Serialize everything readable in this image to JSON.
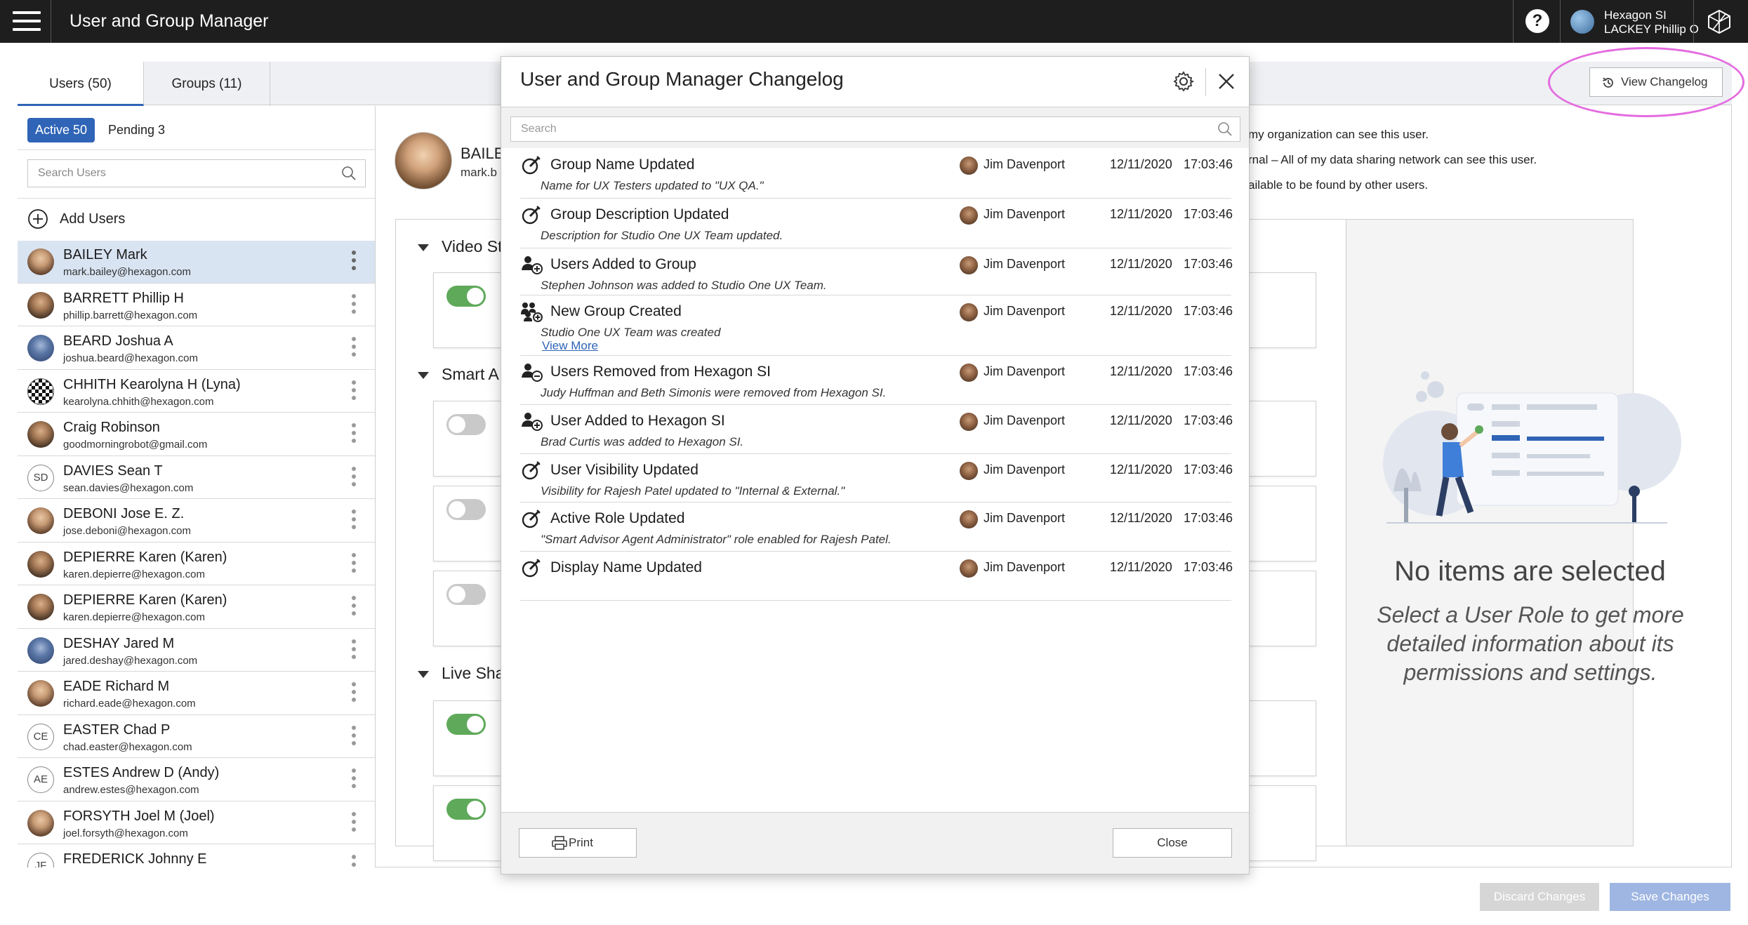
{
  "app": {
    "title": "User and Group Manager"
  },
  "account": {
    "org": "Hexagon SI",
    "name": "LACKEY Phillip O"
  },
  "tabs": [
    {
      "label": "Users (50)"
    },
    {
      "label": "Groups (11)"
    }
  ],
  "changelog_button": {
    "label": "View Changelog"
  },
  "filters": {
    "active": "Active 50",
    "pending": "Pending 3"
  },
  "user_search": {
    "placeholder": "Search Users"
  },
  "add_users": {
    "label": "Add Users"
  },
  "users": [
    {
      "name": "BAILEY Mark",
      "email": "mark.bailey@hexagon.com",
      "avatar": "photo",
      "initials": ""
    },
    {
      "name": "BARRETT Phillip H",
      "email": "phillip.barrett@hexagon.com",
      "avatar": "photo2",
      "initials": ""
    },
    {
      "name": "BEARD Joshua A",
      "email": "joshua.beard@hexagon.com",
      "avatar": "photo3",
      "initials": ""
    },
    {
      "name": "CHHITH Kearolyna H (Lyna)",
      "email": "kearolyna.chhith@hexagon.com",
      "avatar": "checker",
      "initials": ""
    },
    {
      "name": "Craig Robinson",
      "email": "goodmorningrobot@gmail.com",
      "avatar": "photo2",
      "initials": ""
    },
    {
      "name": "DAVIES Sean T",
      "email": "sean.davies@hexagon.com",
      "avatar": "initials",
      "initials": "SD"
    },
    {
      "name": "DEBONI Jose E. Z.",
      "email": "jose.deboni@hexagon.com",
      "avatar": "photo",
      "initials": ""
    },
    {
      "name": "DEPIERRE Karen (Karen)",
      "email": "karen.depierre@hexagon.com",
      "avatar": "photo2",
      "initials": ""
    },
    {
      "name": "DEPIERRE Karen (Karen)",
      "email": "karen.depierre@hexagon.com",
      "avatar": "photo2",
      "initials": ""
    },
    {
      "name": "DESHAY Jared M",
      "email": "jared.deshay@hexagon.com",
      "avatar": "photo3",
      "initials": ""
    },
    {
      "name": "EADE Richard M",
      "email": "richard.eade@hexagon.com",
      "avatar": "photo",
      "initials": ""
    },
    {
      "name": "EASTER Chad P",
      "email": "chad.easter@hexagon.com",
      "avatar": "initials",
      "initials": "CE"
    },
    {
      "name": "ESTES Andrew D (Andy)",
      "email": "andrew.estes@hexagon.com",
      "avatar": "initials",
      "initials": "AE"
    },
    {
      "name": "FORSYTH Joel M (Joel)",
      "email": "joel.forsyth@hexagon.com",
      "avatar": "photo",
      "initials": ""
    },
    {
      "name": "FREDERICK Johnny E",
      "email": "",
      "avatar": "initials",
      "initials": "JF"
    }
  ],
  "detail": {
    "name": "BAILE",
    "email": "mark.b",
    "visibility_lines": [
      "my organization can see this user.",
      "rnal – All of my data sharing network can see this user.",
      "ailable to be found by other users."
    ],
    "sections": [
      "Video St",
      "Smart A",
      "Live Sha"
    ],
    "empty_title": "No items are selected",
    "empty_subtitle": "Select a User Role to get more detailed information about its permissions and settings."
  },
  "footer": {
    "discard": "Discard Changes",
    "save": "Save Changes"
  },
  "modal": {
    "title": "User and Group Manager Changelog",
    "search_placeholder": "Search",
    "print": "Print",
    "close": "Close",
    "entries": [
      {
        "icon": "edit-icon",
        "title": "Group Name Updated",
        "user": "Jim Davenport",
        "date": "12/11/2020",
        "time": "17:03:46",
        "desc": "Name for UX Testers updated to \"UX QA.\"",
        "more": ""
      },
      {
        "icon": "edit-icon",
        "title": "Group Description Updated",
        "user": "Jim Davenport",
        "date": "12/11/2020",
        "time": "17:03:46",
        "desc": "Description for Studio One UX Team updated.",
        "more": ""
      },
      {
        "icon": "user-add-icon",
        "title": "Users Added to Group",
        "user": "Jim Davenport",
        "date": "12/11/2020",
        "time": "17:03:46",
        "desc": "Stephen Johnson was added to Studio One UX Team.",
        "more": ""
      },
      {
        "icon": "group-add-icon",
        "title": "New Group Created",
        "user": "Jim Davenport",
        "date": "12/11/2020",
        "time": "17:03:46",
        "desc": "Studio One UX Team was created",
        "more": "View More"
      },
      {
        "icon": "user-remove-icon",
        "title": "Users Removed from Hexagon SI",
        "user": "Jim Davenport",
        "date": "12/11/2020",
        "time": "17:03:46",
        "desc": "Judy Huffman and Beth Simonis were removed from Hexagon SI.",
        "more": ""
      },
      {
        "icon": "user-add-icon",
        "title": "User Added to Hexagon SI",
        "user": "Jim Davenport",
        "date": "12/11/2020",
        "time": "17:03:46",
        "desc": "Brad Curtis was added to Hexagon SI.",
        "more": ""
      },
      {
        "icon": "edit-icon",
        "title": "User Visibility Updated",
        "user": "Jim Davenport",
        "date": "12/11/2020",
        "time": "17:03:46",
        "desc": "Visibility for Rajesh Patel updated to \"Internal & External.\"",
        "more": ""
      },
      {
        "icon": "edit-icon",
        "title": "Active Role Updated",
        "user": "Jim Davenport",
        "date": "12/11/2020",
        "time": "17:03:46",
        "desc": "\"Smart Advisor Agent Administrator\" role enabled for Rajesh Patel.",
        "more": ""
      },
      {
        "icon": "edit-icon",
        "title": "Display Name Updated",
        "user": "Jim Davenport",
        "date": "12/11/2020",
        "time": "17:03:46",
        "desc": "",
        "more": ""
      }
    ]
  },
  "colors": {
    "accent": "#2f64b6",
    "toggle_on": "#5fa95a",
    "highlight": "#e46be0"
  }
}
